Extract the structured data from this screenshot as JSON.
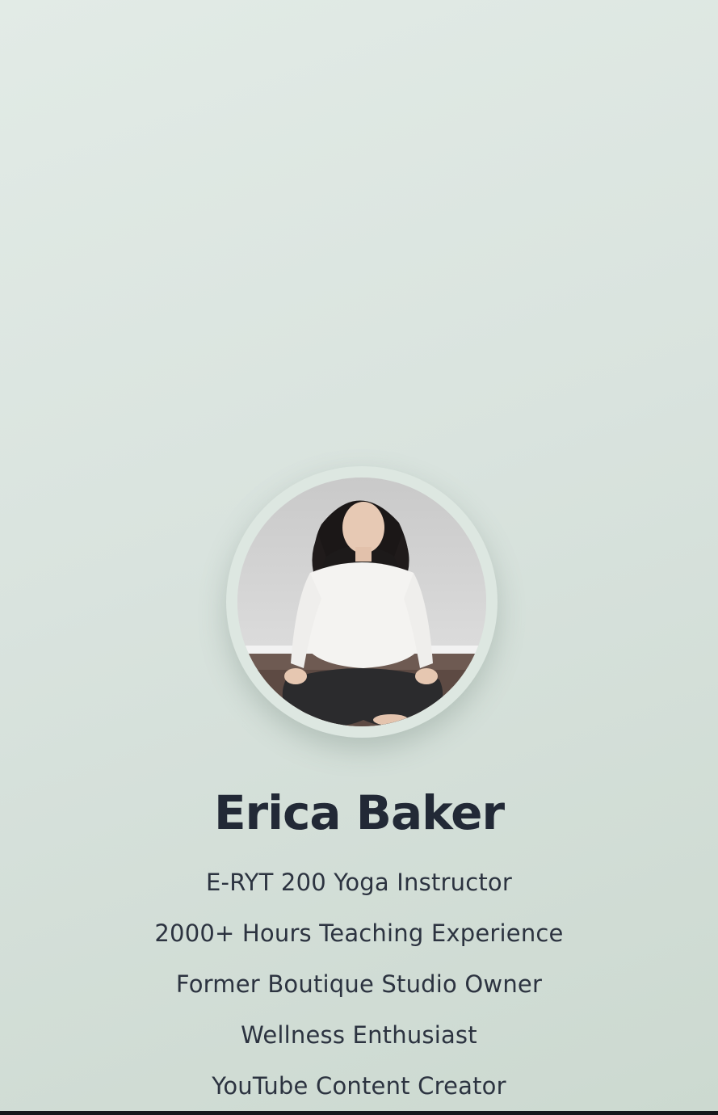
{
  "profile": {
    "name": "Erica Baker",
    "photo_alt": "Portrait of Erica Baker seated cross-legged"
  },
  "credentials": [
    "E-RYT 200 Yoga Instructor",
    "2000+ Hours Teaching Experience",
    "Former Boutique Studio Owner",
    "Wellness Enthusiast",
    "YouTube Content Creator"
  ],
  "colors": {
    "background": "#d9e3de",
    "text": "#222936",
    "avatar_ring": "#dde7e1"
  }
}
